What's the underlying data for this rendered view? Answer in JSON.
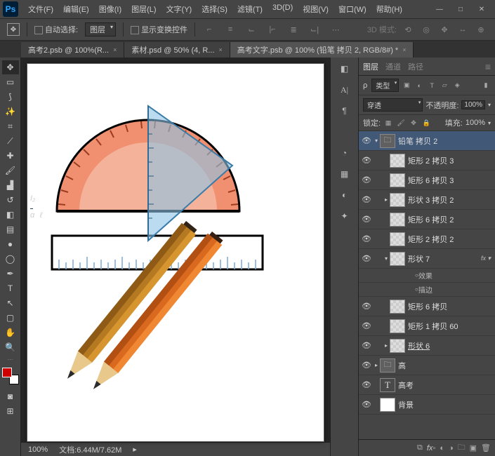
{
  "menu": [
    "文件(F)",
    "编辑(E)",
    "图像(I)",
    "图层(L)",
    "文字(Y)",
    "选择(S)",
    "滤镜(T)",
    "3D(D)",
    "视图(V)",
    "窗口(W)",
    "帮助(H)"
  ],
  "logo": "Ps",
  "options": {
    "autoSelect": "自动选择:",
    "autoSelectKind": "图层",
    "showTransform": "显示变换控件",
    "mode3d": "3D 模式:"
  },
  "tabs": [
    {
      "label": "高考2.psb @ 100%(R...",
      "active": false
    },
    {
      "label": "素材.psd @ 50% (4, R...",
      "active": false
    },
    {
      "label": "高考文字.psb @ 100% (铅笔 拷贝 2, RGB/8#) *",
      "active": true
    }
  ],
  "rightTabs": {
    "layers": "图层",
    "channels": "通道",
    "paths": "路径"
  },
  "layerPanel": {
    "kind": "类型",
    "blend": "穿透",
    "opacityLabel": "不透明度:",
    "opacity": "100%",
    "lockLabel": "锁定:",
    "fillLabel": "填充:",
    "fill": "100%"
  },
  "layers": [
    {
      "vis": true,
      "indent": 0,
      "twisty": "▾",
      "thumb": "folder",
      "name": "铅笔 拷贝 2",
      "sel": true
    },
    {
      "vis": true,
      "indent": 1,
      "twisty": "",
      "thumb": "ck",
      "name": "矩形 2 拷贝 3"
    },
    {
      "vis": true,
      "indent": 1,
      "twisty": "",
      "thumb": "ck",
      "name": "矩形 6 拷贝 3"
    },
    {
      "vis": true,
      "indent": 1,
      "twisty": "▸",
      "thumb": "ck",
      "name": "形状 3 拷贝 2"
    },
    {
      "vis": true,
      "indent": 1,
      "twisty": "",
      "thumb": "ck",
      "name": "矩形 6 拷贝 2"
    },
    {
      "vis": true,
      "indent": 1,
      "twisty": "",
      "thumb": "ck",
      "name": "矩形 2 拷贝 2"
    },
    {
      "vis": true,
      "indent": 1,
      "twisty": "▾",
      "thumb": "ck",
      "name": "形状 7",
      "fx": true
    },
    {
      "vis": false,
      "indent": 2,
      "sub": true,
      "name": "效果",
      "bullet": true
    },
    {
      "vis": false,
      "indent": 2,
      "sub": true,
      "name": "描边",
      "bullet": true
    },
    {
      "vis": true,
      "indent": 1,
      "twisty": "",
      "thumb": "ck",
      "name": "矩形 6 拷贝"
    },
    {
      "vis": true,
      "indent": 1,
      "twisty": "",
      "thumb": "ck",
      "name": "矩形 1 拷贝 60"
    },
    {
      "vis": true,
      "indent": 1,
      "twisty": "▸",
      "thumb": "ck",
      "name": "形状 6",
      "underline": true
    },
    {
      "vis": true,
      "indent": 0,
      "twisty": "▸",
      "thumb": "folder",
      "name": "高"
    },
    {
      "vis": true,
      "indent": 0,
      "twisty": "",
      "thumb": "text",
      "name": "高考"
    },
    {
      "vis": true,
      "indent": 0,
      "twisty": "",
      "thumb": "white",
      "name": "背景"
    }
  ],
  "status": {
    "zoom": "100%",
    "docsize": "文档:6.44M/7.62M"
  },
  "annotation": {
    "top": "I₂",
    "bot": "α",
    "end": "ℓ"
  }
}
